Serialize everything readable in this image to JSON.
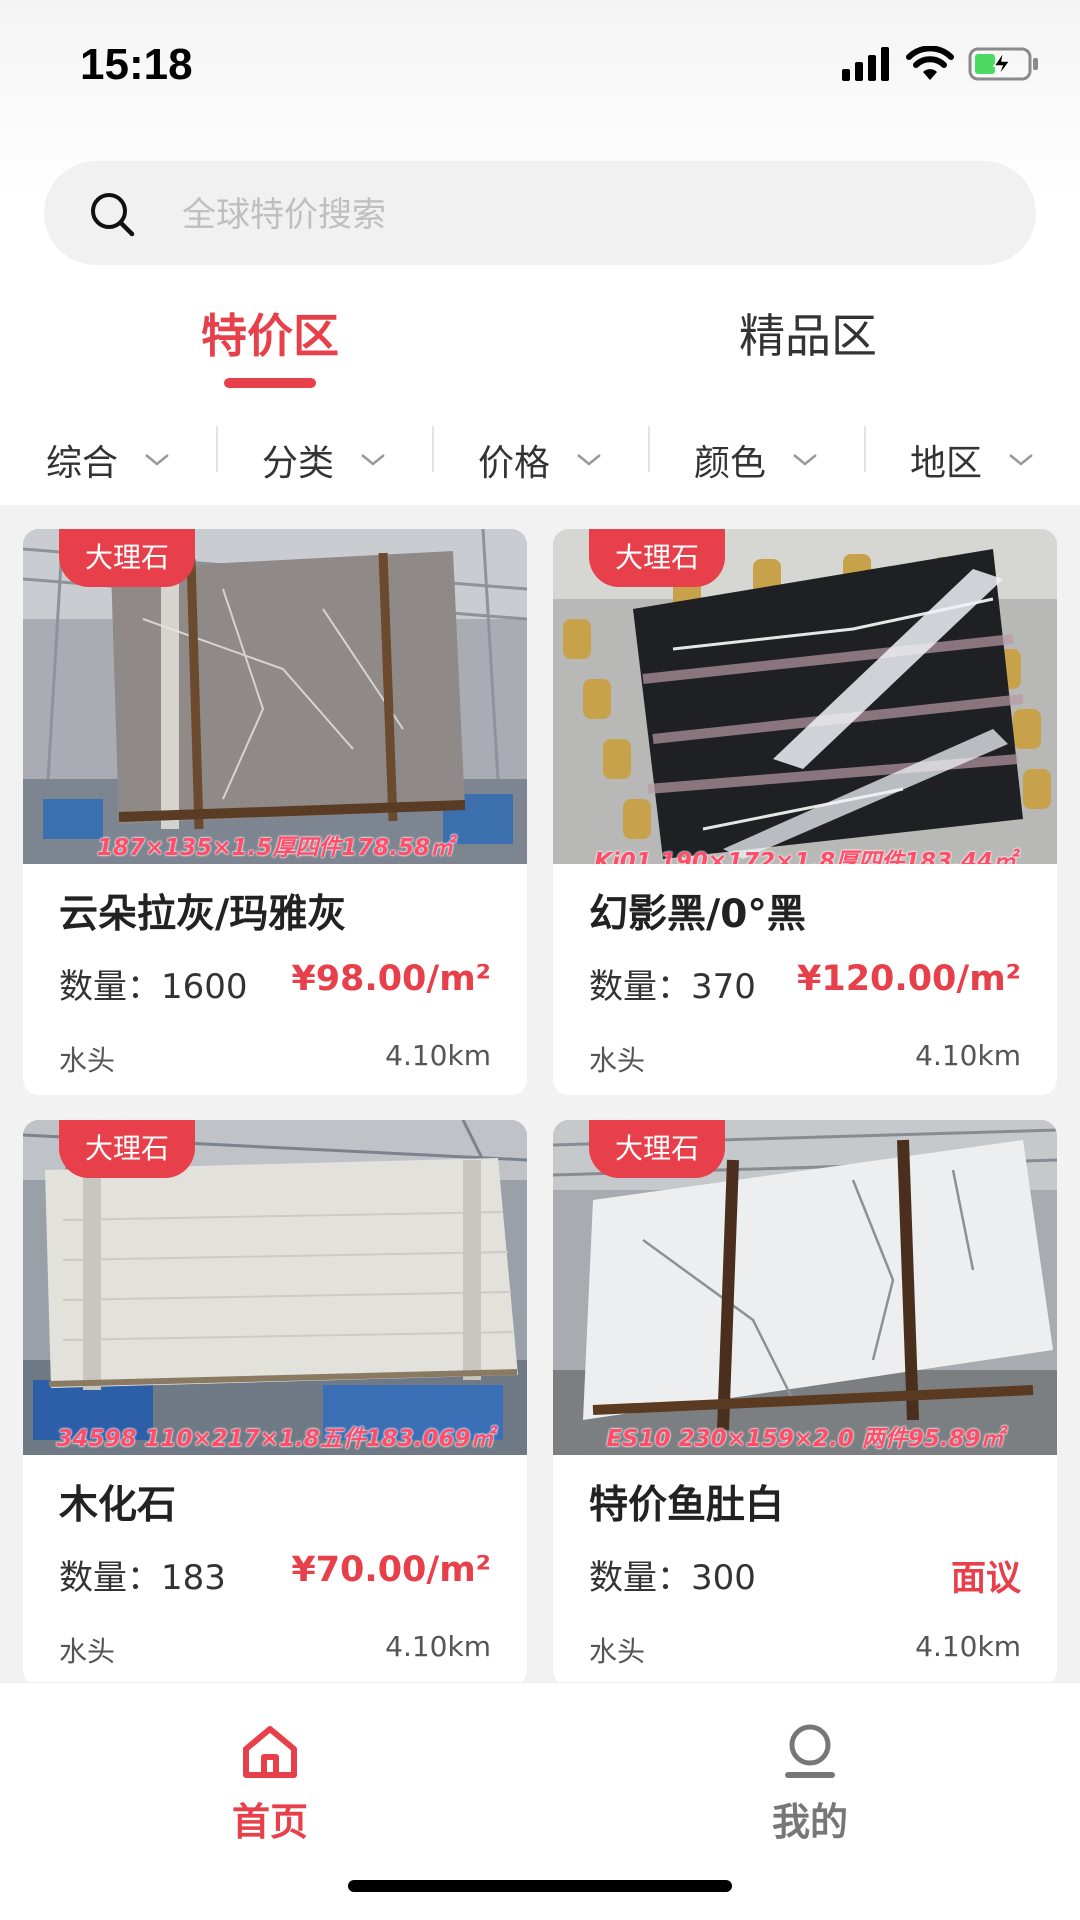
{
  "status_bar": {
    "time": "15:18"
  },
  "search": {
    "placeholder": "全球特价搜索"
  },
  "tabs": [
    {
      "label": "特价区",
      "active": true
    },
    {
      "label": "精品区",
      "active": false
    }
  ],
  "filters": [
    "综合",
    "分类",
    "价格",
    "颜色",
    "地区"
  ],
  "products": [
    {
      "tag": "大理石",
      "image_caption": "187×135×1.5厚四件178.58㎡",
      "title": "云朵拉灰/玛雅灰",
      "quantity_label": "数量：",
      "quantity": "1600",
      "price": "¥98.00/m²",
      "location": "水头",
      "distance": "4.10km"
    },
    {
      "tag": "大理石",
      "image_caption": "Ki01 190×172×1.8厚四件183.44㎡",
      "title": "幻影黑/0°黑",
      "quantity_label": "数量：",
      "quantity": "370",
      "price": "¥120.00/m²",
      "location": "水头",
      "distance": "4.10km"
    },
    {
      "tag": "大理石",
      "image_caption": "34598 110×217×1.8五件183.069㎡",
      "title": "木化石",
      "quantity_label": "数量：",
      "quantity": "183",
      "price": "¥70.00/m²",
      "location": "水头",
      "distance": "4.10km"
    },
    {
      "tag": "大理石",
      "image_caption": "ES10 230×159×2.0 两件95.89㎡",
      "title": "特价鱼肚白",
      "quantity_label": "数量：",
      "quantity": "300",
      "price": "面议",
      "location": "水头",
      "distance": "4.10km"
    }
  ],
  "bottom_nav": [
    {
      "label": "首页",
      "icon": "home-icon",
      "active": true
    },
    {
      "label": "我的",
      "icon": "profile-icon",
      "active": false
    }
  ],
  "colors": {
    "accent": "#e8404a",
    "background": "#f2f2f2"
  }
}
